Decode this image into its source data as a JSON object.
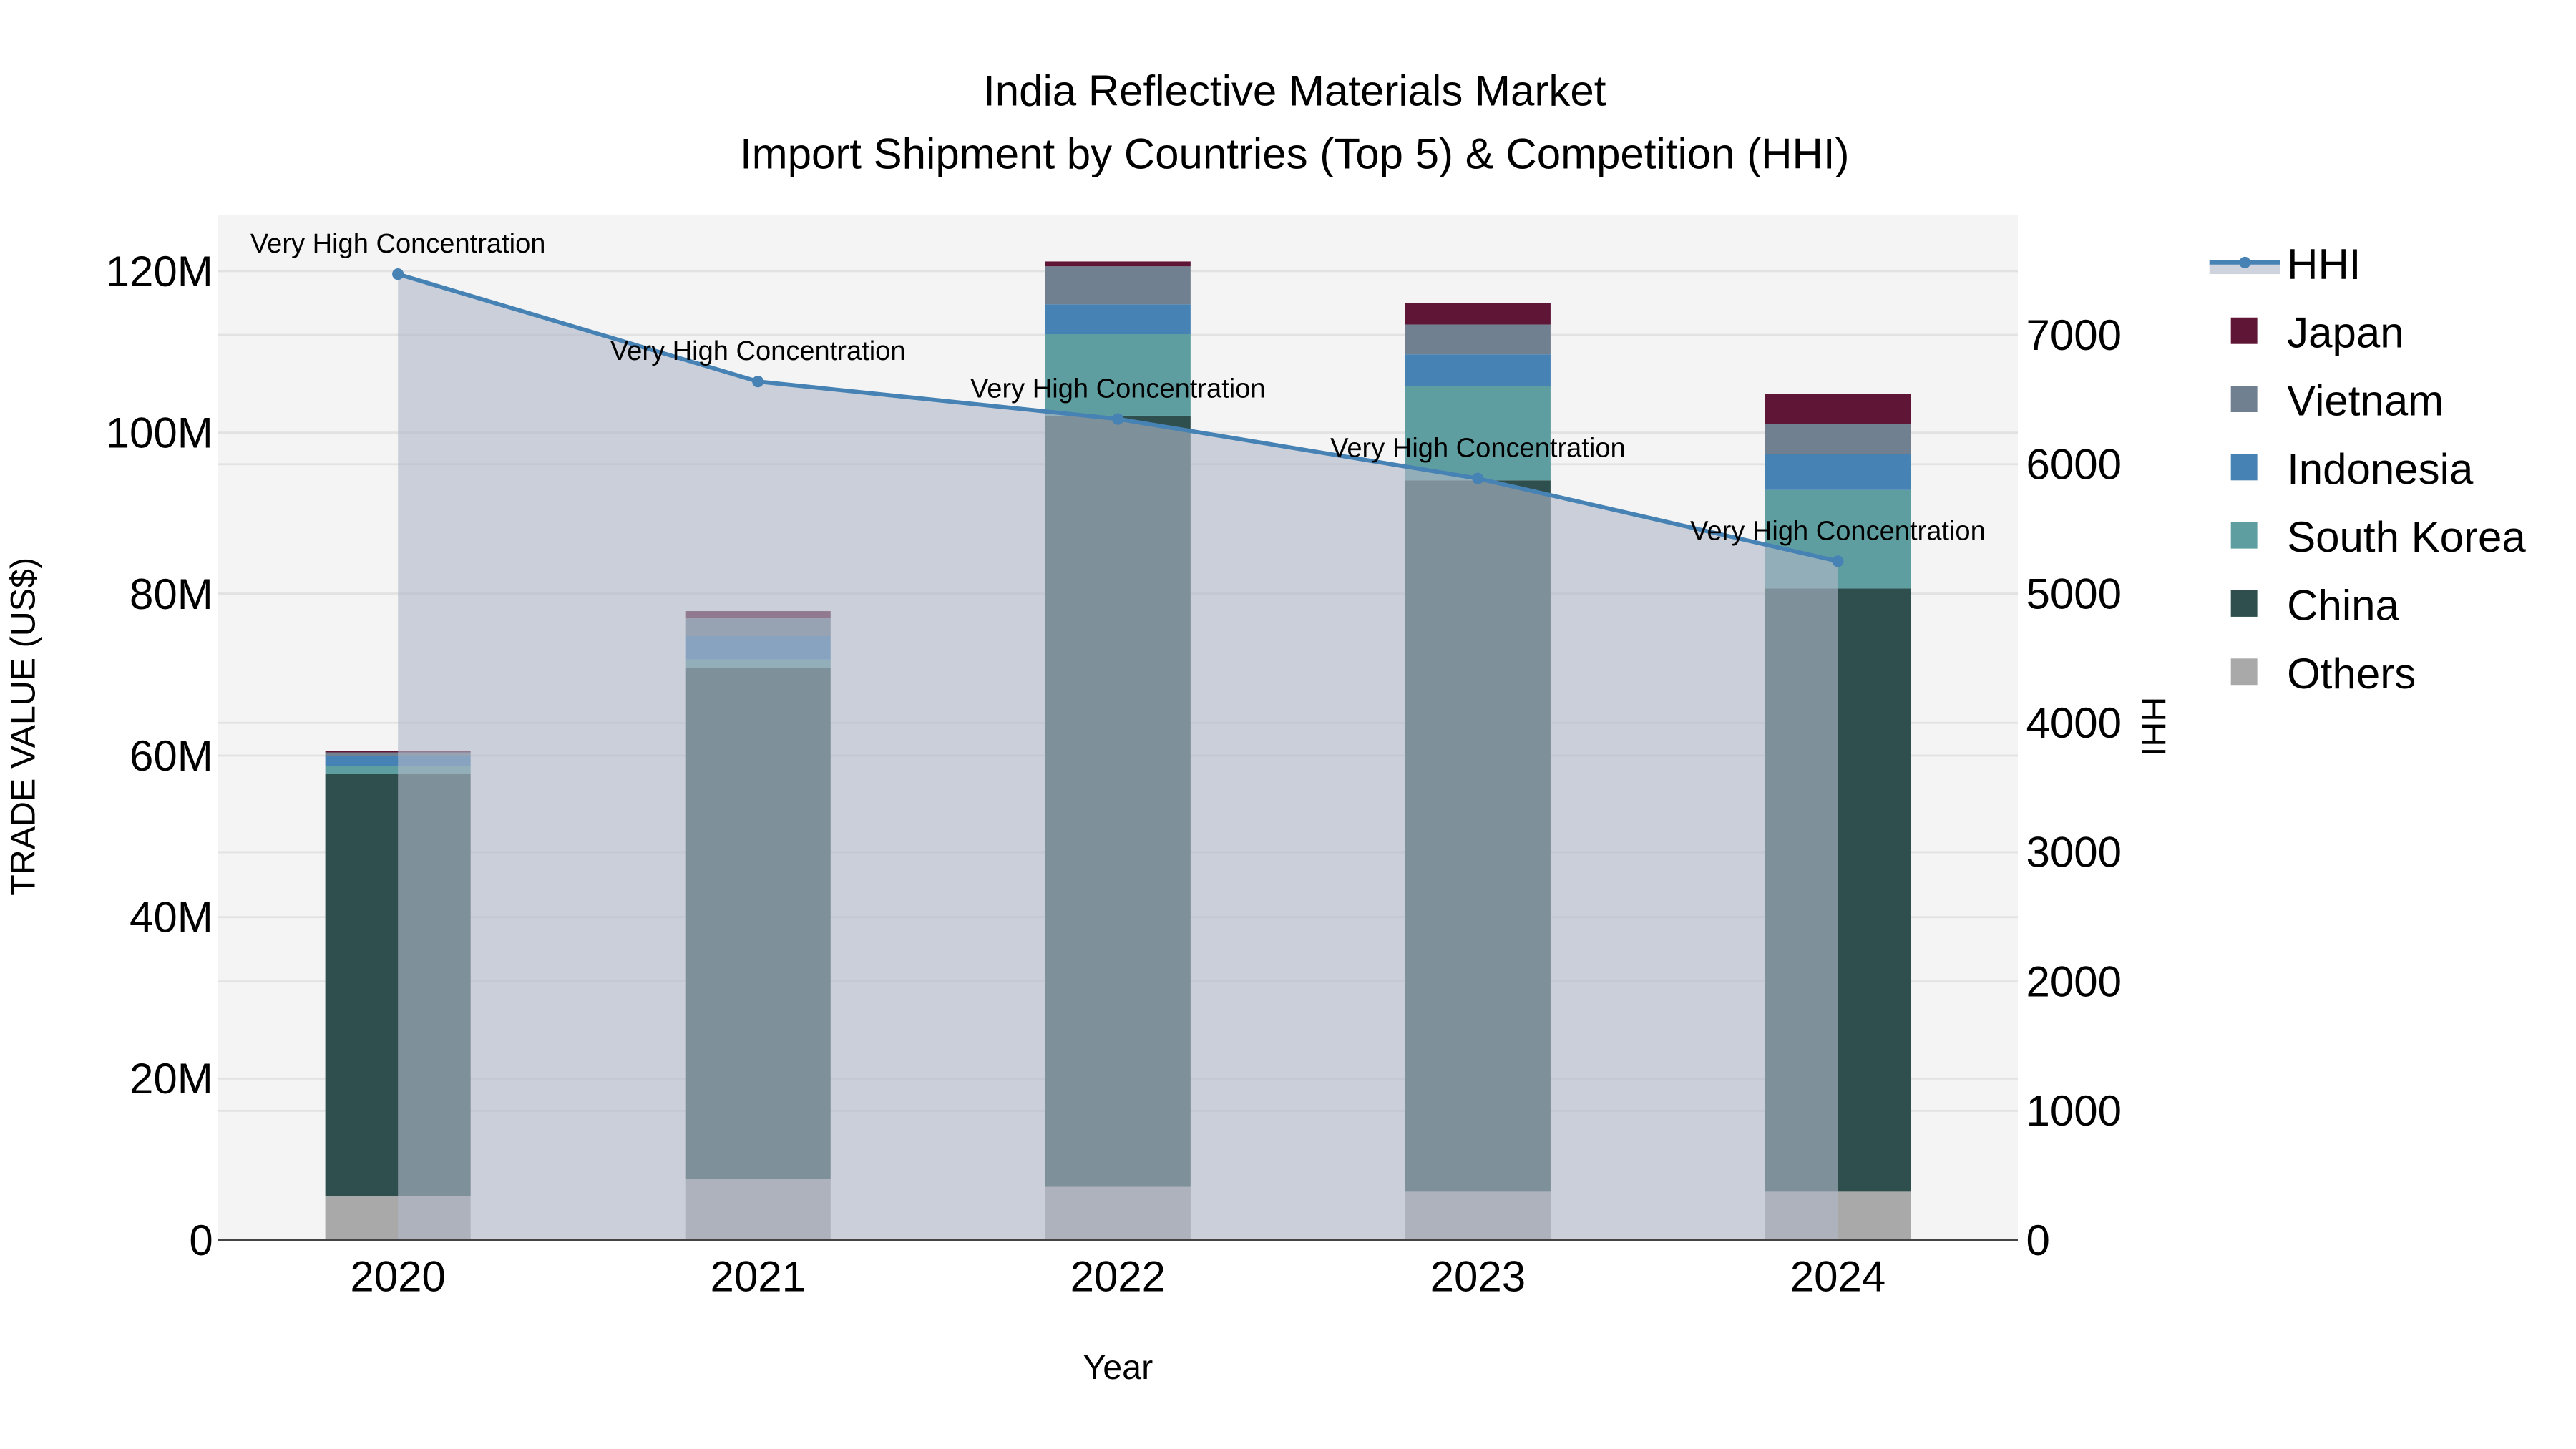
{
  "chart_data": {
    "type": "bar",
    "title": "India Reflective Materials Market",
    "subtitle": "Import Shipment by Countries (Top 5) & Competition (HHI)",
    "xlabel": "Year",
    "ylabel": "TRADE VALUE (US$)",
    "y2label": "HHI",
    "categories": [
      "2020",
      "2021",
      "2022",
      "2023",
      "2024"
    ],
    "ylim": [
      0,
      127
    ],
    "y_ticks": [
      0,
      20,
      40,
      60,
      80,
      100,
      120
    ],
    "y_tick_labels": [
      "0",
      "20M",
      "40M",
      "60M",
      "80M",
      "100M",
      "120M"
    ],
    "y2lim": [
      0,
      7930
    ],
    "y2_ticks": [
      0,
      1000,
      2000,
      3000,
      4000,
      5000,
      6000,
      7000
    ],
    "y2_tick_labels": [
      "0",
      "1000",
      "2000",
      "3000",
      "4000",
      "5000",
      "6000",
      "7000"
    ],
    "value_unit": "million US$",
    "grid": true,
    "legend_position": "right",
    "stacked": true,
    "series": [
      {
        "name": "Others",
        "color": "#a9a9a9",
        "values": [
          5.5,
          7.6,
          6.6,
          6.0,
          6.0
        ]
      },
      {
        "name": "China",
        "color": "#2f4f4f",
        "values": [
          52.2,
          63.3,
          95.5,
          88.1,
          74.7
        ]
      },
      {
        "name": "South Korea",
        "color": "#5f9ea0",
        "values": [
          1.0,
          1.0,
          10.1,
          11.7,
          12.2
        ]
      },
      {
        "name": "Indonesia",
        "color": "#4682b4",
        "values": [
          1.3,
          2.9,
          3.7,
          3.9,
          4.5
        ]
      },
      {
        "name": "Vietnam",
        "color": "#708090",
        "values": [
          0.4,
          2.2,
          4.7,
          3.7,
          3.7
        ]
      },
      {
        "name": "Japan",
        "color": "#5f1535",
        "values": [
          0.2,
          0.9,
          0.6,
          2.7,
          3.7
        ]
      }
    ],
    "hhi": {
      "name": "HHI",
      "color": "#4682b4",
      "values": [
        7470,
        6640,
        6350,
        5890,
        5250
      ],
      "annotations": [
        "Very High Concentration",
        "Very High Concentration",
        "Very High Concentration",
        "Very High Concentration",
        "Very High Concentration"
      ]
    },
    "legend_order": [
      "HHI",
      "Japan",
      "Vietnam",
      "Indonesia",
      "South Korea",
      "China",
      "Others"
    ]
  }
}
